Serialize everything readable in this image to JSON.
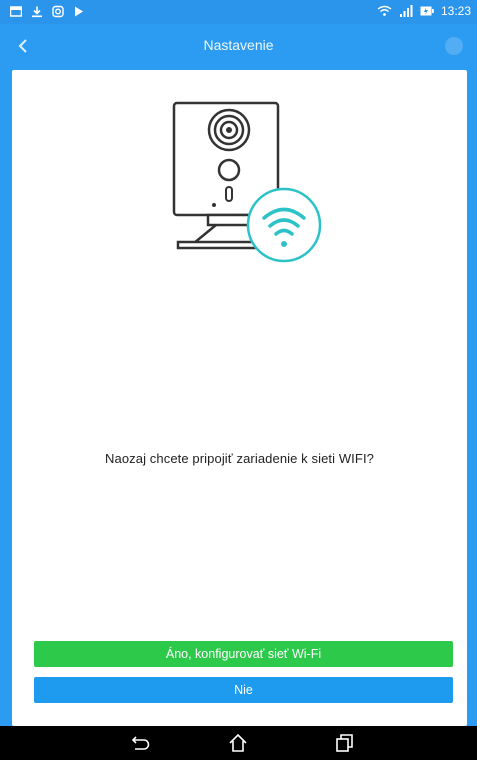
{
  "status_bar": {
    "time": "13:23",
    "icons": [
      "gallery-icon",
      "download-icon",
      "instagram-icon",
      "play-store-icon",
      "wifi-icon",
      "signal-icon",
      "battery-icon"
    ]
  },
  "header": {
    "title": "Nastavenie",
    "back_icon": "back-chevron-icon"
  },
  "main": {
    "illustration": "camera-wifi-illustration",
    "question": "Naozaj chcete pripojiť zariadenie k sieti WIFI?",
    "confirm_label": "Áno, konfigurovať sieť Wi-Fi",
    "cancel_label": "Nie"
  },
  "nav_bar": {
    "icons": [
      "back-icon",
      "home-icon",
      "recents-icon"
    ]
  },
  "colors": {
    "header": "#2c9cf2",
    "confirm_button": "#2dc94b",
    "cancel_button": "#1e9bef",
    "wifi_accent": "#2dc2c8"
  }
}
